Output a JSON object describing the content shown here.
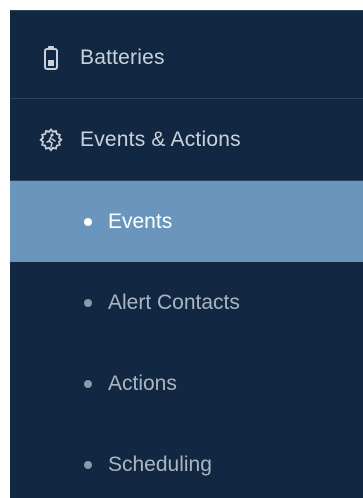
{
  "colors": {
    "sidebar_bg": "#122842",
    "active_bg": "#6a95bc",
    "text": "#c9d1dc",
    "active_text": "#ffffff",
    "divider": "#2a4460"
  },
  "sidebar": {
    "items": [
      {
        "label": "Batteries",
        "icon": "battery-icon"
      },
      {
        "label": "Events & Actions",
        "icon": "gear-runner-icon"
      }
    ],
    "subitems": [
      {
        "label": "Events",
        "active": true
      },
      {
        "label": "Alert Contacts",
        "active": false
      },
      {
        "label": "Actions",
        "active": false
      },
      {
        "label": "Scheduling",
        "active": false
      }
    ]
  }
}
